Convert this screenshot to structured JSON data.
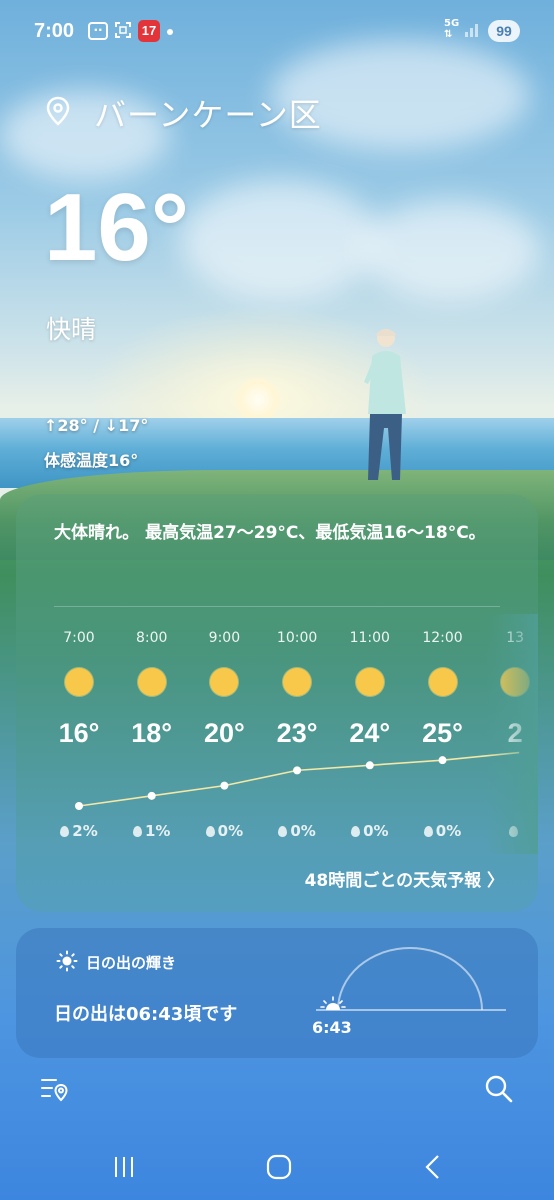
{
  "status_bar": {
    "time": "7:00",
    "badge": "17",
    "network": "5G",
    "battery": "99"
  },
  "weather": {
    "location": "バーンケーン区",
    "temperature": "16°",
    "condition": "快晴",
    "high_low": "↑28° / ↓17°",
    "feels_like": "体感温度16°"
  },
  "forecast": {
    "summary": "大体晴れ。 最高気温27～29°C、最低気温16～18°C。",
    "hours": [
      {
        "time": "7:00",
        "icon": "sun-icon",
        "temp": "16°",
        "rain": "2%"
      },
      {
        "time": "8:00",
        "icon": "sun-icon",
        "temp": "18°",
        "rain": "1%"
      },
      {
        "time": "9:00",
        "icon": "sun-icon",
        "temp": "20°",
        "rain": "0%"
      },
      {
        "time": "10:00",
        "icon": "sun-icon",
        "temp": "23°",
        "rain": "0%"
      },
      {
        "time": "11:00",
        "icon": "sun-icon",
        "temp": "24°",
        "rain": "0%"
      },
      {
        "time": "12:00",
        "icon": "sun-icon",
        "temp": "25°",
        "rain": "0%"
      },
      {
        "time": "13",
        "icon": "sun-icon",
        "temp": "2",
        "rain": ""
      }
    ],
    "link_48h": "48時間ごとの天気予報 〉"
  },
  "sunrise": {
    "title": "日の出の輝き",
    "text": "日の出は06:43頃です",
    "time": "6:43"
  },
  "colors": {
    "sun": "#f7c84a",
    "badge": "#e3343a",
    "trend_line": "#f3e8a6"
  }
}
